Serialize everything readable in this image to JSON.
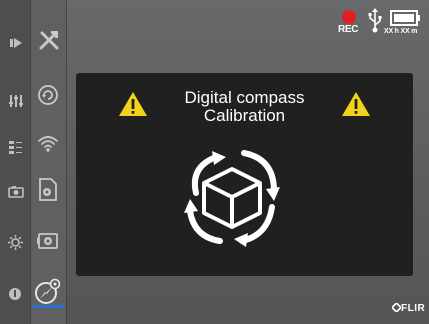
{
  "status": {
    "rec_label": "REC",
    "battery_time": "XX h XX m",
    "rec_color": "#e02020"
  },
  "sidebar": {
    "outer_icons": [
      "play-icon",
      "adjust-sliders-icon",
      "list-icon",
      "camera-icon",
      "brightness-icon",
      "power-icon"
    ],
    "inner_icons": [
      "tools-icon",
      "rotation-icon",
      "wifi-icon",
      "document-settings-icon",
      "thermal-camera-icon",
      "compass-settings-icon"
    ],
    "selected_item": "compass-settings-icon",
    "selection_color": "#2b6fd0"
  },
  "dialog": {
    "title_line1": "Digital compass",
    "title_line2": "Calibration",
    "warning_color": "#f3d31a",
    "icon": "compass-calibration-icon"
  },
  "brand": {
    "logo_text": "FLIR"
  }
}
